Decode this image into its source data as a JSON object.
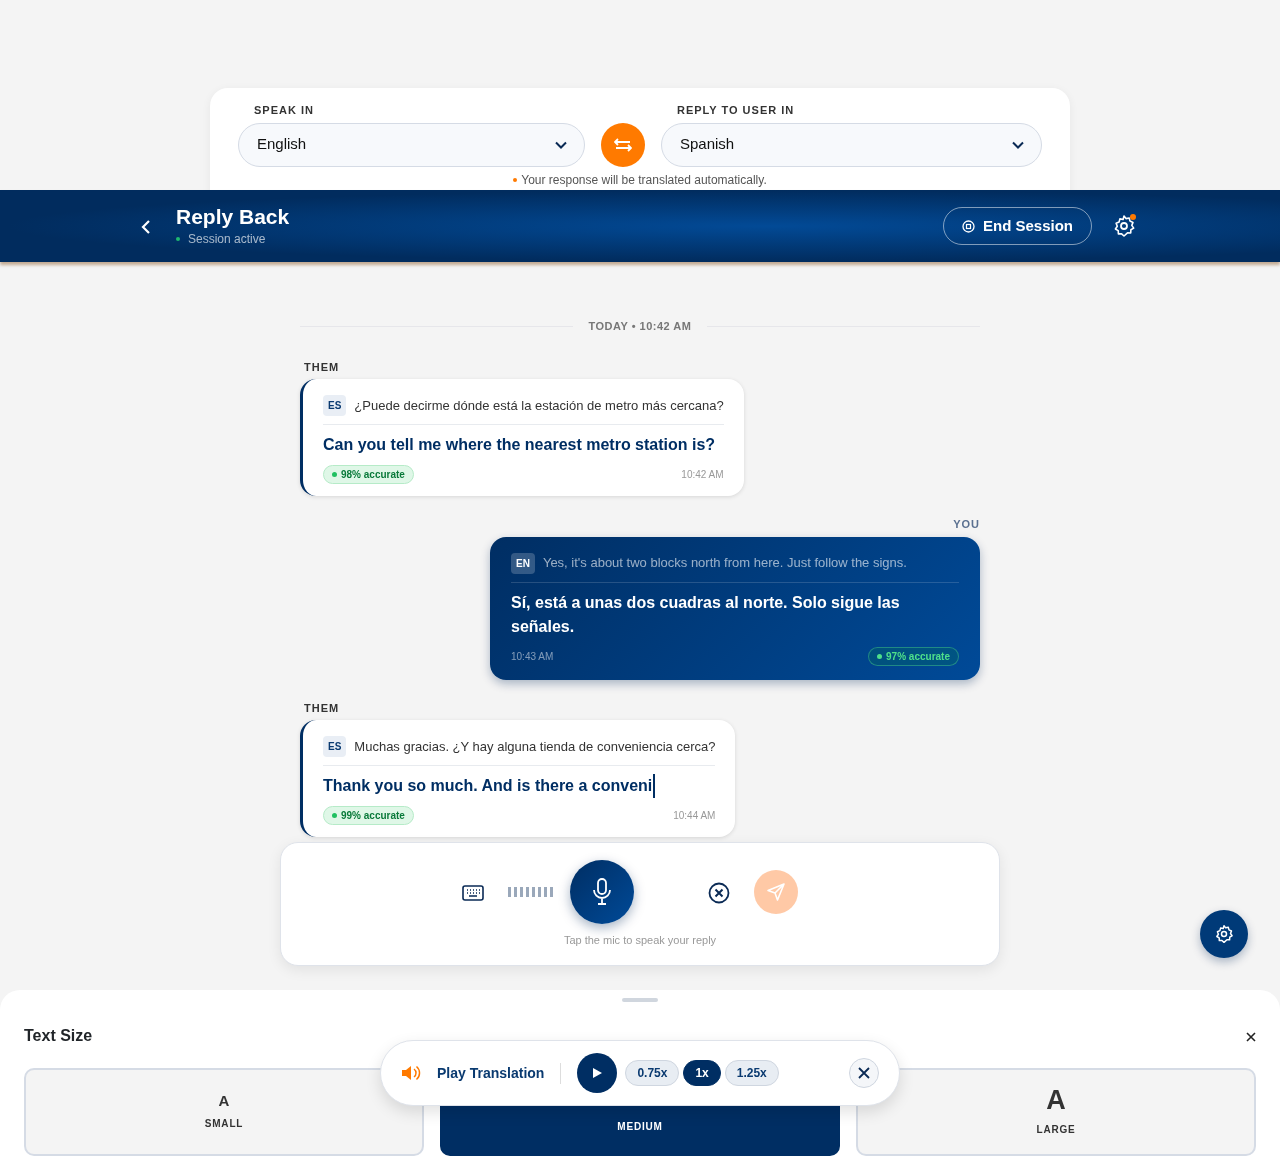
{
  "language_panel": {
    "speak_in": {
      "label": "SPEAK IN",
      "value": "English"
    },
    "reply_in": {
      "label": "REPLY TO USER IN",
      "value": "Spanish"
    },
    "note": "Your response will be translated automatically."
  },
  "header": {
    "title": "Reply Back",
    "status": "Session active",
    "end_session": "End Session",
    "settings_alert": true
  },
  "divider": "TODAY • 10:42 AM",
  "messages": [
    {
      "kind": "them",
      "sender": "THEM",
      "lang": "ES",
      "original": "¿Puede decirme dónde está la estación de metro más cercana?",
      "translation": "Can you tell me where the nearest metro station is?",
      "accuracy": "98% accurate",
      "time": "10:42 AM",
      "typing": false
    },
    {
      "kind": "you",
      "sender": "YOU",
      "lang": "EN",
      "original": "Yes, it's about two blocks north from here. Just follow the signs.",
      "translation": "Sí, está a unas dos cuadras al norte. Solo sigue las señales.",
      "accuracy": "97% accurate",
      "time": "10:43 AM",
      "typing": false
    },
    {
      "kind": "them",
      "sender": "THEM",
      "lang": "ES",
      "original": "Muchas gracias. ¿Y hay alguna tienda de conveniencia cerca?",
      "translation": "Thank you so much. And is there a conveni",
      "accuracy": "99% accurate",
      "time": "10:44 AM",
      "typing": true
    }
  ],
  "input_bar": {
    "hint": "Tap the mic to speak your reply",
    "send_disabled": true
  },
  "text_size": {
    "title": "Text Size",
    "options": [
      {
        "glyph": "A",
        "label": "SMALL",
        "selected": false
      },
      {
        "label": "MEDIUM",
        "selected": true
      },
      {
        "glyph": "A",
        "label": "LARGE",
        "selected": false
      }
    ]
  },
  "player": {
    "label": "Play Translation",
    "speeds": [
      {
        "label": "0.75x",
        "selected": false
      },
      {
        "label": "1x",
        "selected": true
      },
      {
        "label": "1.25x",
        "selected": false
      }
    ]
  }
}
